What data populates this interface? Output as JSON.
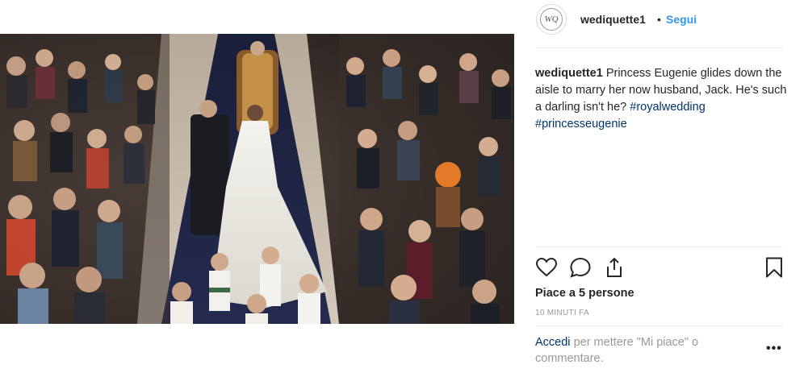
{
  "post": {
    "username": "wediquette1",
    "separator": "•",
    "follow_label": "Segui",
    "avatar_monogram": "WQ",
    "caption_user": "wediquette1",
    "caption_text": "Princess Eugenie glides down the aisle to marry her now husband, Jack. He's such a darling isn't he?",
    "hashtags": [
      "#royalwedding",
      "#princesseugenie"
    ],
    "likes_text": "Piace a 5 persone",
    "time_text": "10 MINUTI FA",
    "login_link": "Accedi",
    "login_rest": "per mettere \"Mi piace\" o commentare.",
    "more_label": "•••"
  },
  "icons": {
    "like": "heart-icon",
    "comment": "comment-icon",
    "share": "share-icon",
    "save": "bookmark-icon",
    "more": "more-options-icon"
  },
  "colors": {
    "link_blue": "#3897f0",
    "hashtag": "#003569",
    "muted": "#999999",
    "text": "#262626"
  }
}
